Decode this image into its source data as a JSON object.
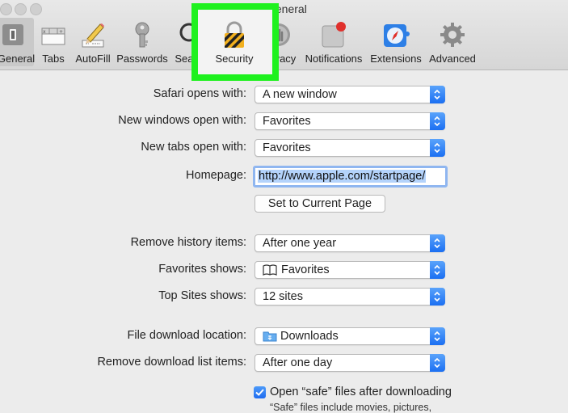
{
  "window": {
    "title": "General"
  },
  "toolbar": {
    "tabs": [
      {
        "label": "General",
        "icon": "switch-icon"
      },
      {
        "label": "Tabs",
        "icon": "tabs-icon"
      },
      {
        "label": "AutoFill",
        "icon": "pencil-form-icon"
      },
      {
        "label": "Passwords",
        "icon": "key-icon"
      },
      {
        "label": "Search",
        "icon": "magnifier-icon"
      },
      {
        "label": "Security",
        "icon": "padlock-icon"
      },
      {
        "label": "Privacy",
        "icon": "privacy-hand-icon"
      },
      {
        "label": "Notifications",
        "icon": "notification-badge-icon"
      },
      {
        "label": "Extensions",
        "icon": "compass-puzzle-icon"
      },
      {
        "label": "Advanced",
        "icon": "gear-icon"
      }
    ],
    "highlight_color": "#1ef11e"
  },
  "settings": {
    "safari_opens_label": "Safari opens with:",
    "safari_opens_value": "A new window",
    "new_windows_label": "New windows open with:",
    "new_windows_value": "Favorites",
    "new_tabs_label": "New tabs open with:",
    "new_tabs_value": "Favorites",
    "homepage_label": "Homepage:",
    "homepage_value": "http://www.apple.com/startpage/",
    "set_current_label": "Set to Current Page",
    "remove_history_label": "Remove history items:",
    "remove_history_value": "After one year",
    "favorites_shows_label": "Favorites shows:",
    "favorites_shows_value": "Favorites",
    "top_sites_label": "Top Sites shows:",
    "top_sites_value": "12 sites",
    "download_location_label": "File download location:",
    "download_location_value": "Downloads",
    "remove_download_label": "Remove download list items:",
    "remove_download_value": "After one day",
    "open_safe_label": "Open “safe” files after downloading",
    "open_safe_checked": true,
    "open_safe_sub": "“Safe” files include movies, pictures,"
  }
}
